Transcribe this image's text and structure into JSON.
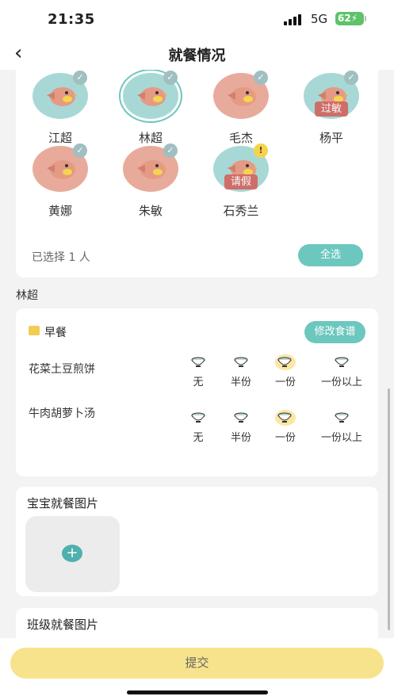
{
  "status": {
    "time": "21:35",
    "network": "5G",
    "battery": "62"
  },
  "nav": {
    "back_icon": "‹",
    "title": "就餐情况"
  },
  "kids": [
    {
      "name": "江超",
      "status": "check",
      "tag": ""
    },
    {
      "name": "林超",
      "status": "check",
      "tag": "",
      "selected": true
    },
    {
      "name": "毛杰",
      "status": "check",
      "tag": ""
    },
    {
      "name": "杨平",
      "status": "check",
      "tag": "过敏"
    },
    {
      "name": "黄娜",
      "status": "check",
      "tag": ""
    },
    {
      "name": "朱敏",
      "status": "check",
      "tag": ""
    },
    {
      "name": "石秀兰",
      "status": "warning",
      "tag": "请假"
    }
  ],
  "selection": {
    "info": "已选择 1 人",
    "select_all": "全选"
  },
  "current_child": "林超",
  "meal": {
    "title": "早餐",
    "edit_button": "修改食谱",
    "options": [
      "无",
      "半份",
      "一份",
      "一份以上"
    ],
    "dishes": [
      {
        "name": "花菜土豆煎饼",
        "selected": "一份"
      },
      {
        "name": "牛肉胡萝卜汤",
        "selected": "一份"
      }
    ]
  },
  "baby_photos": {
    "title": "宝宝就餐图片",
    "add_icon": "+"
  },
  "class_photos": {
    "title": "班级就餐图片"
  },
  "footer": {
    "submit": "提交"
  },
  "colors": {
    "accent": "#6cc7be",
    "submit_bg": "#f7e38c",
    "teal_avatar": "#a8d8d6",
    "pink_avatar": "#e8ab9b",
    "tag": "#d26660"
  }
}
